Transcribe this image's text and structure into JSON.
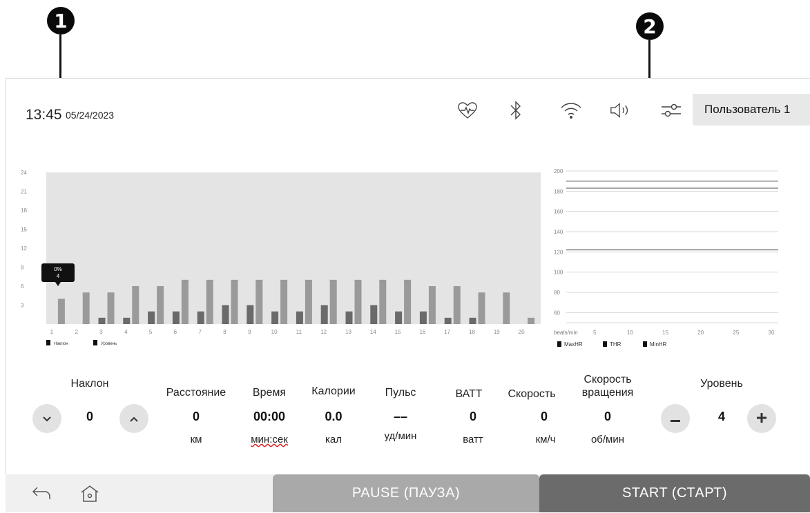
{
  "callouts": {
    "one": "1",
    "two": "2"
  },
  "status": {
    "time": "13:45",
    "date": "05/24/2023",
    "icons": [
      "heart-rate-icon",
      "bluetooth-icon",
      "wifi-icon",
      "volume-icon",
      "settings-sliders-icon"
    ],
    "user_label": "Пользователь 1"
  },
  "left_chart": {
    "type": "bar",
    "y_ticks": [
      "24",
      "21",
      "18",
      "15",
      "12",
      "9",
      "6",
      "3"
    ],
    "categories": [
      "1",
      "2",
      "3",
      "4",
      "5",
      "6",
      "7",
      "8",
      "9",
      "10",
      "11",
      "12",
      "13",
      "14",
      "15",
      "16",
      "17",
      "18",
      "19",
      "20"
    ],
    "ylim": [
      0,
      24
    ],
    "series": [
      {
        "name": "Наклон",
        "values": [
          0,
          0,
          1,
          1,
          2,
          2,
          2,
          3,
          3,
          2,
          2,
          3,
          2,
          3,
          2,
          2,
          1,
          1,
          0,
          0
        ],
        "color": "#6a6a6a"
      },
      {
        "name": "Уровень",
        "values": [
          4,
          5,
          5,
          6,
          6,
          7,
          7,
          7,
          7,
          7,
          7,
          7,
          7,
          7,
          7,
          6,
          6,
          5,
          5,
          1
        ],
        "color": "#9a9a9a"
      }
    ],
    "tooltip": {
      "line1": "0%",
      "line2": "4"
    },
    "legend": [
      "Наклон",
      "Уровень"
    ]
  },
  "right_chart": {
    "type": "line",
    "y_ticks": [
      "200",
      "180",
      "160",
      "140",
      "120",
      "100",
      "80",
      "60"
    ],
    "x_label": "beats/min",
    "x_ticks": [
      "5",
      "10",
      "15",
      "20",
      "25",
      "30"
    ],
    "ylim": [
      50,
      200
    ],
    "xlim": [
      0,
      30
    ],
    "lines": [
      {
        "name": "MaxHR",
        "value": 190
      },
      {
        "name": "THR",
        "value": 183
      },
      {
        "name": "MinHR",
        "value": 122
      }
    ],
    "legend": [
      "MaxHR",
      "THR",
      "MinHR"
    ]
  },
  "controls": {
    "incline": {
      "label": "Наклон",
      "value": "0"
    },
    "distance": {
      "label": "Расстояние",
      "value": "0",
      "unit": "км"
    },
    "time": {
      "label": "Время",
      "value": "00:00",
      "unit": "мин:сек"
    },
    "calories": {
      "label": "Калории",
      "value": "0.0",
      "unit": "кал"
    },
    "pulse": {
      "label": "Пульс",
      "value": "––",
      "unit": "уд/мин"
    },
    "watt": {
      "label": "ВАТТ",
      "value": "0",
      "unit": "ватт"
    },
    "speed": {
      "label": "Скорость",
      "value": "0",
      "unit": "км/ч"
    },
    "rpm": {
      "label_line1": "Скорость",
      "label_line2": "вращения",
      "value": "0",
      "unit": "об/мин"
    },
    "level": {
      "label": "Уровень",
      "value": "4"
    }
  },
  "footer": {
    "pause_label": "PAUSE (ПАУЗА)",
    "start_label": "START (СТАРТ)"
  }
}
